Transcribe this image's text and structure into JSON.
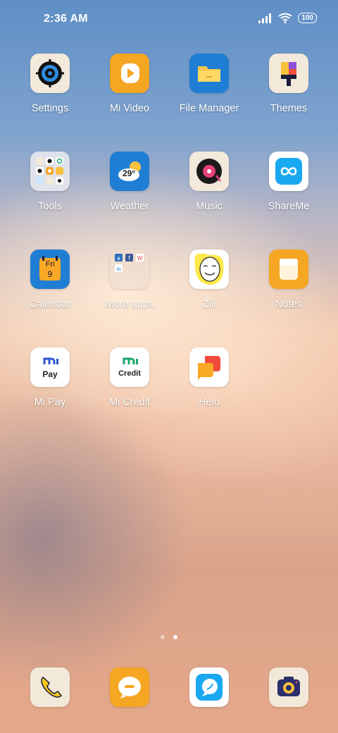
{
  "status": {
    "time": "2:36 AM",
    "battery": "100"
  },
  "apps": [
    {
      "label": "Settings"
    },
    {
      "label": "Mi Video"
    },
    {
      "label": "File Manager"
    },
    {
      "label": "Themes"
    },
    {
      "label": "Tools"
    },
    {
      "label": "Weather",
      "temp": "29°"
    },
    {
      "label": "Music"
    },
    {
      "label": "ShareMe"
    },
    {
      "label": "Calendar",
      "day": "Fri",
      "date": "9"
    },
    {
      "label": "More apps"
    },
    {
      "label": "Zili"
    },
    {
      "label": "Notes"
    },
    {
      "label": "Mi Pay",
      "logo": "Pay"
    },
    {
      "label": "Mi Credit",
      "logo": "Credit"
    },
    {
      "label": "Helo"
    }
  ],
  "pagination": {
    "pages": 2,
    "active": 2
  },
  "colors": {
    "accent_orange": "#f5a623",
    "blue_tile": "#1f7ed4",
    "cyan_tile": "#1aa9f0",
    "mi_green": "#1aa66b"
  }
}
